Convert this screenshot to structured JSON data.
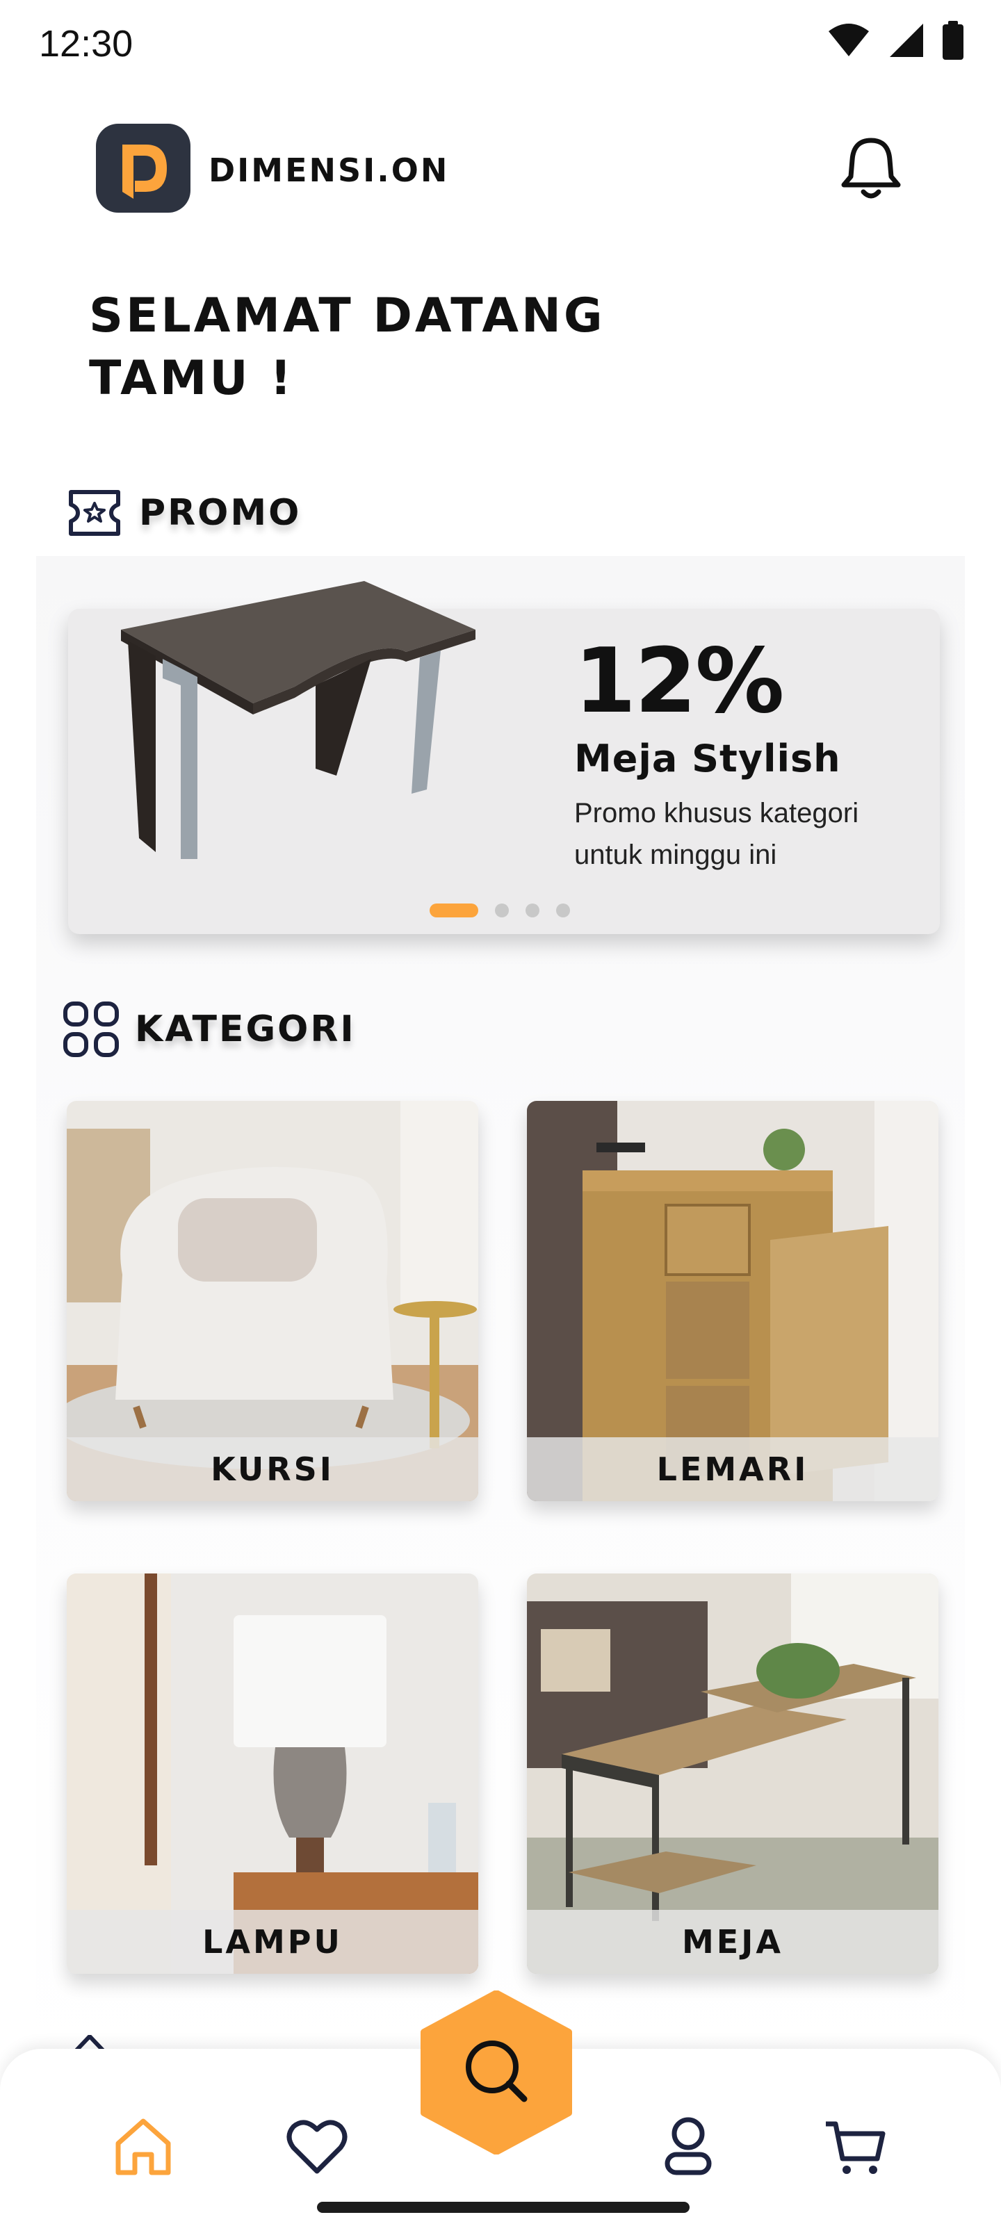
{
  "status_bar": {
    "time": "12:30"
  },
  "header": {
    "brand": "DIMENSI.ON"
  },
  "welcome": {
    "title": "SELAMAT DATANG\nTAMU !"
  },
  "promo": {
    "section_title": "PROMO",
    "percent": "12%",
    "title": "Meja Stylish",
    "description": "Promo khusus kategori untuk minggu ini",
    "slides_total": 4,
    "active_slide": 1
  },
  "kategori": {
    "section_title": "KATEGORI",
    "items": [
      {
        "label": "KURSI"
      },
      {
        "label": "LEMARI"
      },
      {
        "label": "LAMPU"
      },
      {
        "label": "MEJA"
      }
    ]
  },
  "nav": {
    "items": [
      "home-icon",
      "heart-icon",
      "search-icon",
      "user-icon",
      "cart-icon"
    ],
    "active": "home-icon",
    "accent": "#fca43c"
  }
}
